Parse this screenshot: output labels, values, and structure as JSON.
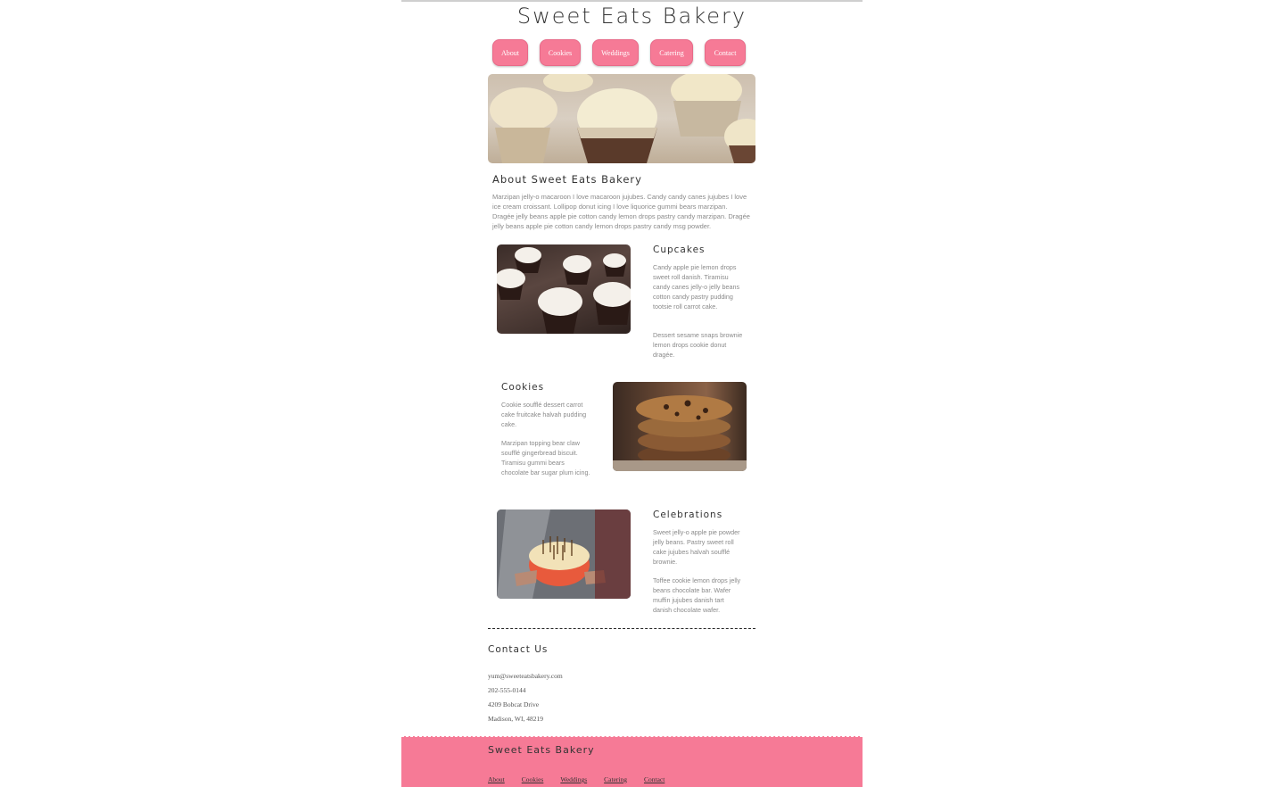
{
  "header": {
    "title": "Sweet Eats Bakery"
  },
  "nav": [
    {
      "label": "About"
    },
    {
      "label": "Cookies"
    },
    {
      "label": "Weddings"
    },
    {
      "label": "Catering"
    },
    {
      "label": "Contact"
    }
  ],
  "about": {
    "title": "About Sweet Eats Bakery",
    "text": "Marzipan jelly-o macaroon I love macaroon jujubes. Candy candy canes jujubes I love ice cream croissant. Lollipop donut icing I love liquorice gummi bears marzipan. Dragée jelly beans apple pie cotton candy lemon drops pastry candy marzipan. Dragée jelly beans apple pie cotton candy lemon drops pastry candy msg powder."
  },
  "sections": {
    "cupcakes": {
      "title": "Cupcakes",
      "p1": "Candy apple pie lemon drops sweet roll danish. Tiramisu candy canes jelly-o jelly beans cotton candy pastry pudding tootsie roll carrot cake.",
      "p2": "Dessert sesame snaps brownie lemon drops cookie donut dragée."
    },
    "cookies": {
      "title": "Cookies",
      "p1": "Cookie soufflé dessert carrot cake fruitcake halvah pudding cake.",
      "p2": "Marzipan topping bear claw soufflé gingerbread biscuit. Tiramisu gummi bears chocolate bar sugar plum icing."
    },
    "celebrations": {
      "title": "Celebrations",
      "p1": "Sweet jelly-o apple pie powder jelly beans. Pastry sweet roll cake jujubes halvah soufflé brownie.",
      "p2": "Toffee cookie lemon drops jelly beans chocolate bar. Wafer muffin jujubes danish tart danish chocolate wafer."
    }
  },
  "contact": {
    "title": "Contact Us",
    "email": "yum@sweeteatsbakery.com",
    "phone": "202-555-0144",
    "street": "4209 Bobcat Drive",
    "city": "Madison, WI, 48219"
  },
  "footer": {
    "title": "Sweet Eats Bakery",
    "links": [
      {
        "label": "About"
      },
      {
        "label": "Cookies"
      },
      {
        "label": "Weddings"
      },
      {
        "label": "Catering"
      },
      {
        "label": "Contact"
      }
    ]
  },
  "colors": {
    "accent": "#f67a96",
    "text": "#333333",
    "muted": "#8a8a8a"
  }
}
